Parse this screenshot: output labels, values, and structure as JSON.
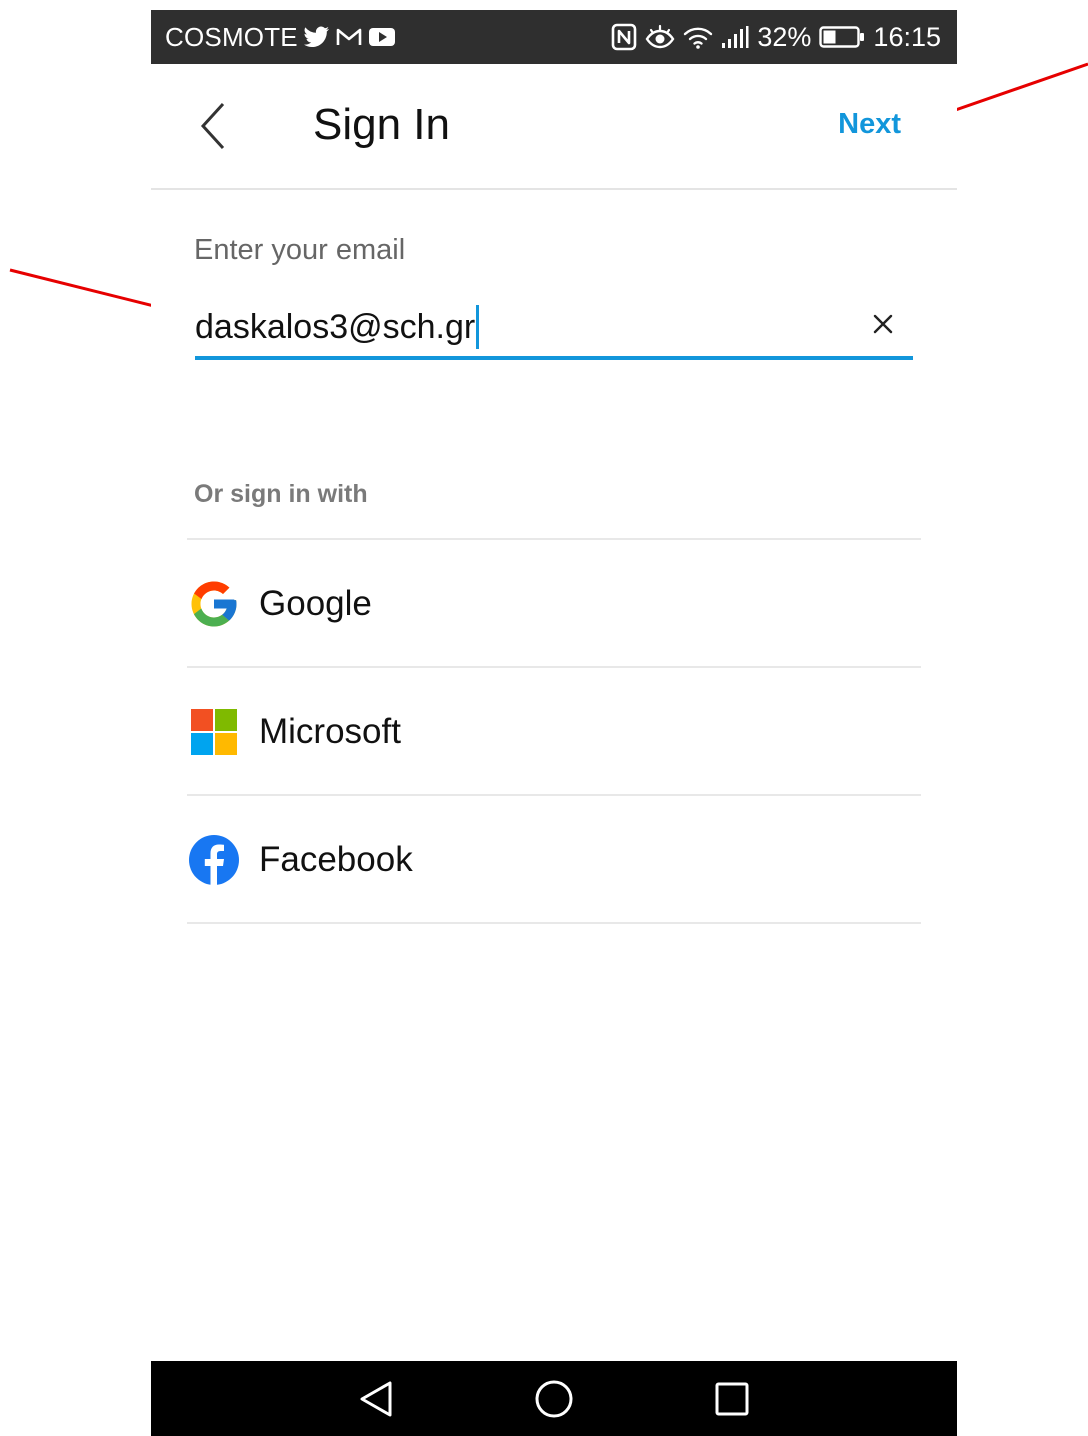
{
  "status_bar": {
    "carrier": "COSMOTE",
    "battery_percent": "32%",
    "time": "16:15"
  },
  "header": {
    "title": "Sign In",
    "next_label": "Next"
  },
  "email": {
    "label": "Enter your email",
    "value": "daskalos3@sch.gr"
  },
  "alternatives": {
    "label": "Or sign in with",
    "providers": [
      {
        "label": "Google"
      },
      {
        "label": "Microsoft"
      },
      {
        "label": "Facebook"
      }
    ]
  },
  "colors": {
    "accent": "#1296db",
    "annotation_arrow": "#e60000",
    "status_bar_bg": "#2f2f2f",
    "nav_bar_bg": "#000000"
  }
}
